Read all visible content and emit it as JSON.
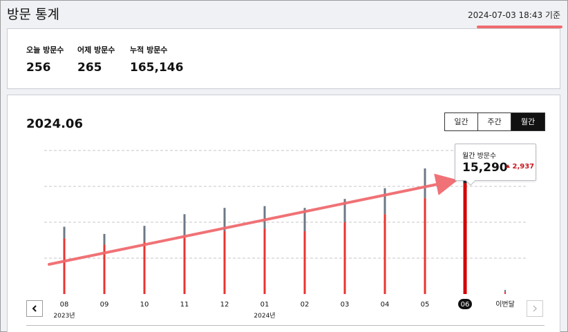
{
  "header": {
    "title": "방문 통계",
    "timestamp": "2024-07-03 18:43 기준"
  },
  "stats": [
    {
      "label": "오늘 방문수",
      "value": "256"
    },
    {
      "label": "어제 방문수",
      "value": "265"
    },
    {
      "label": "누적 방문수",
      "value": "165,146"
    }
  ],
  "chart": {
    "period_title": "2024.06",
    "tabs": [
      {
        "label": "일간",
        "active": false
      },
      {
        "label": "주간",
        "active": false
      },
      {
        "label": "월간",
        "active": true
      }
    ],
    "tooltip": {
      "label": "월간 방문수",
      "value": "15,290",
      "delta": "2,937",
      "delta_icon": "triangle-up-icon"
    },
    "year_labels": [
      {
        "label": "2023년",
        "index": 0
      },
      {
        "label": "2024년",
        "index": 5
      }
    ],
    "colors": {
      "primary": "#e8342f",
      "primary_selected": "#d40000",
      "secondary": "#6c7886",
      "secondary_selected": "#1e2530",
      "annotation": "#f06b6f"
    }
  },
  "chart_data": {
    "type": "bar",
    "categories": [
      "08",
      "09",
      "10",
      "11",
      "12",
      "01",
      "02",
      "03",
      "04",
      "05",
      "06",
      "이번달"
    ],
    "selected_index": 10,
    "series": [
      {
        "values": [
          6200,
          5500,
          5800,
          6400,
          7000,
          7300,
          7000,
          8000,
          8900,
          10700,
          12353,
          100
        ]
      },
      {
        "values": [
          1300,
          1200,
          1800,
          2500,
          2600,
          2500,
          2600,
          2600,
          2900,
          3300,
          2937,
          100
        ]
      }
    ],
    "ylim": [
      0,
      16000
    ],
    "grid": true
  }
}
